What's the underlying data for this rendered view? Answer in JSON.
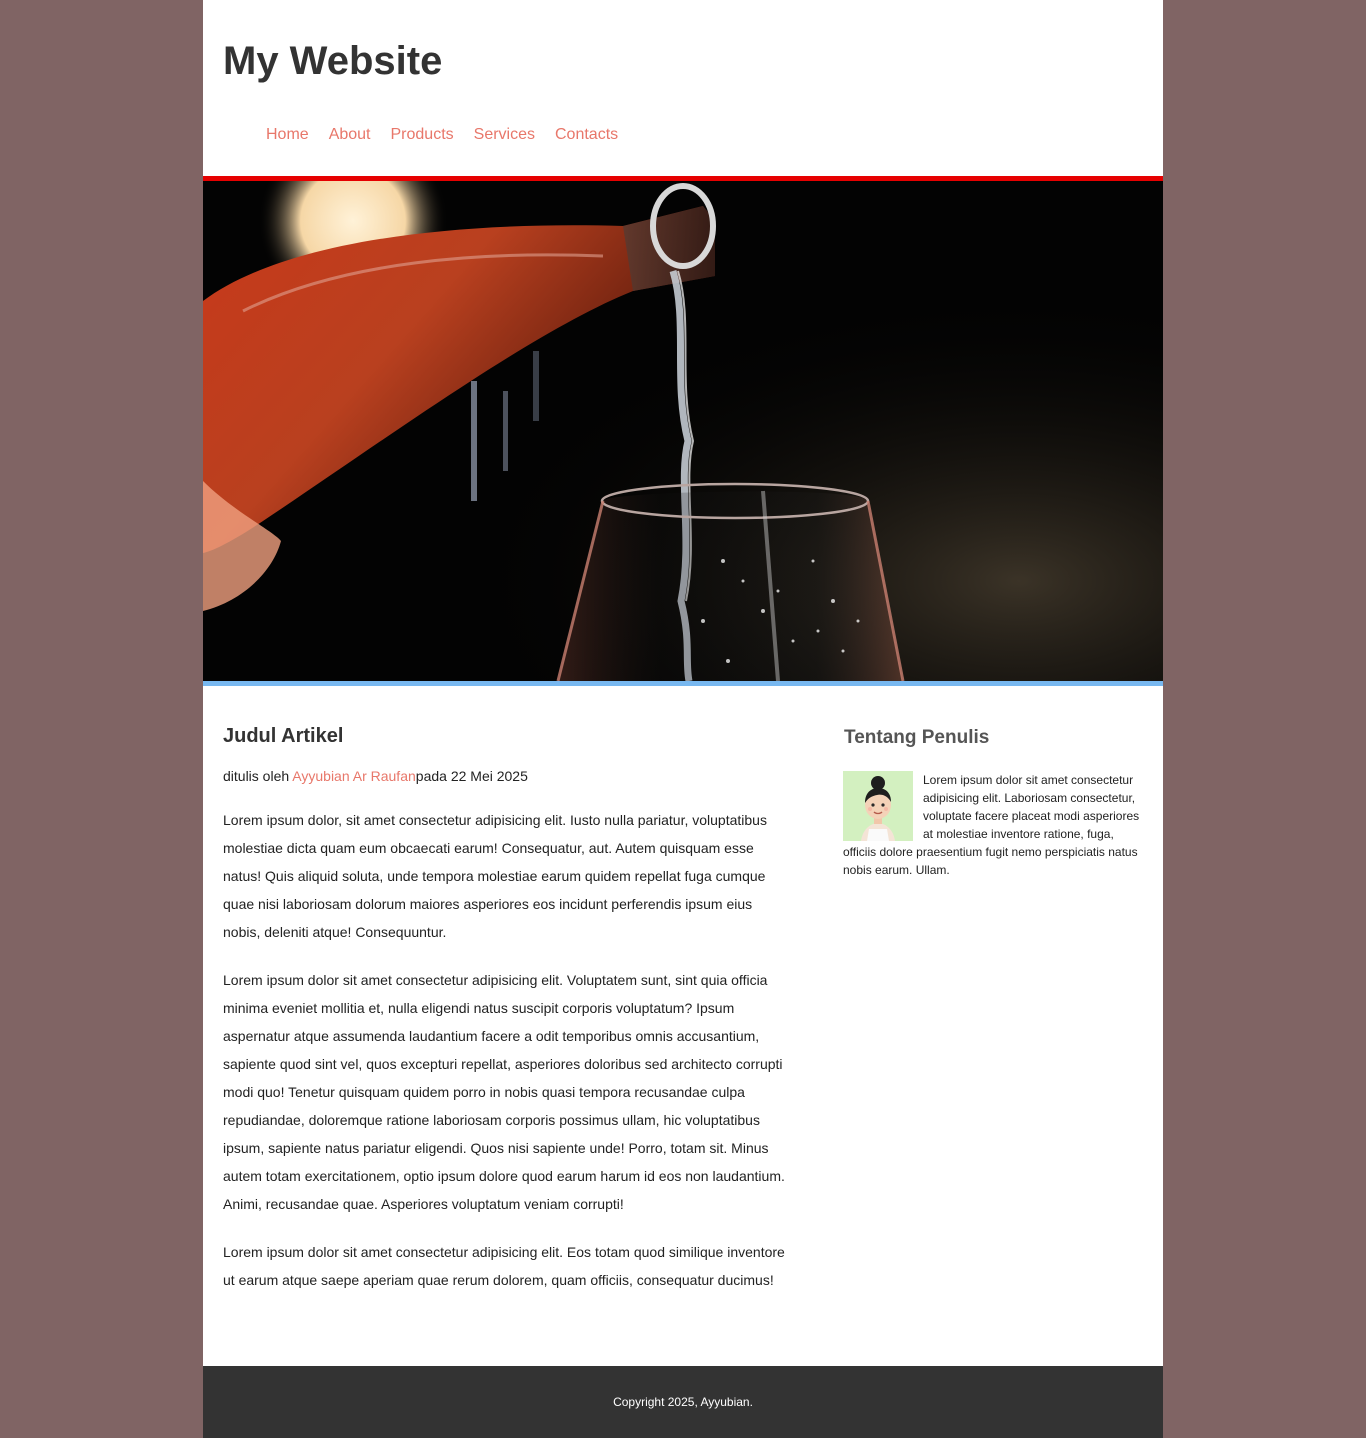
{
  "header": {
    "site_title": "My Website",
    "nav": [
      {
        "label": "Home"
      },
      {
        "label": "About"
      },
      {
        "label": "Products"
      },
      {
        "label": "Services"
      },
      {
        "label": "Contacts"
      }
    ]
  },
  "colors": {
    "page_background": "#806464",
    "accent_link": "#e8776a",
    "hero_top_border": "#e60000",
    "hero_bottom_border": "#78b8f0",
    "footer_background": "#333333"
  },
  "article": {
    "title": "Judul Artikel",
    "byline_prefix": "ditulis oleh ",
    "author_link": "Ayyubian Ar Raufan",
    "byline_suffix": "pada 22 Mei 2025",
    "paragraphs": [
      "Lorem ipsum dolor, sit amet consectetur adipisicing elit. Iusto nulla pariatur, voluptatibus molestiae dicta quam eum obcaecati earum! Consequatur, aut. Autem quisquam esse natus! Quis aliquid soluta, unde tempora molestiae earum quidem repellat fuga cumque quae nisi laboriosam dolorum maiores asperiores eos incidunt perferendis ipsum eius nobis, deleniti atque! Consequuntur.",
      "Lorem ipsum dolor sit amet consectetur adipisicing elit. Voluptatem sunt, sint quia officia minima eveniet mollitia et, nulla eligendi natus suscipit corporis voluptatum? Ipsum aspernatur atque assumenda laudantium facere a odit temporibus omnis accusantium, sapiente quod sint vel, quos excepturi repellat, asperiores doloribus sed architecto corrupti modi quo! Tenetur quisquam quidem porro in nobis quasi tempora recusandae culpa repudiandae, doloremque ratione laboriosam corporis possimus ullam, hic voluptatibus ipsum, sapiente natus pariatur eligendi. Quos nisi sapiente unde! Porro, totam sit. Minus autem totam exercitationem, optio ipsum dolore quod earum harum id eos non laudantium. Animi, recusandae quae. Asperiores voluptatum veniam corrupti!",
      "Lorem ipsum dolor sit amet consectetur adipisicing elit. Eos totam quod similique inventore ut earum atque saepe aperiam quae rerum dolorem, quam officiis, consequatur ducimus!"
    ]
  },
  "sidebar": {
    "title": "Tentang Penulis",
    "avatar_icon": "avatar-illustration",
    "bio": "Lorem ipsum dolor sit amet consectetur adipisicing elit. Laboriosam consectetur, voluptate facere placeat modi asperiores at molestiae inventore ratione, fuga, officiis dolore praesentium fugit nemo perspiciatis natus nobis earum. Ullam."
  },
  "footer": {
    "copyright": "Copyright 2025, Ayyubian."
  }
}
